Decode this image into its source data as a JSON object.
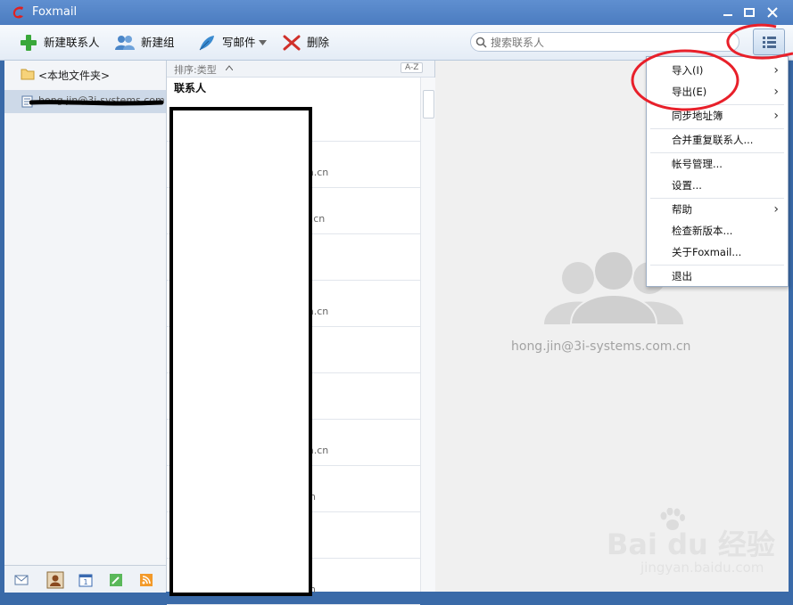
{
  "window": {
    "title": "Foxmail"
  },
  "toolbar": {
    "new_contact": "新建联系人",
    "new_group": "新建组",
    "write_mail": "写邮件",
    "delete": "删除"
  },
  "search": {
    "placeholder": "搜索联系人"
  },
  "sidebar": {
    "local_folder": "<本地文件夹>",
    "account": "hong.jin@3i-systems.com"
  },
  "list": {
    "sort_label": "排序:类型",
    "az_label": "A-Z",
    "group_label": "联系人",
    "rows": [
      {
        "email": ""
      },
      {
        "email": "m.cn"
      },
      {
        "email": "a.cn"
      },
      {
        "email": "o"
      },
      {
        "email": "m.cn"
      },
      {
        "email": ""
      },
      {
        "email": ""
      },
      {
        "email": "m.cn"
      },
      {
        "email": "cn"
      },
      {
        "email": ""
      },
      {
        "email": "cn"
      }
    ]
  },
  "detail": {
    "email": "hong.jin@3i-systems.com.cn"
  },
  "menu": {
    "items": [
      {
        "label": "导入(I)",
        "submenu": true
      },
      {
        "label": "导出(E)",
        "submenu": true
      },
      {
        "label": "同步地址簿",
        "submenu": true
      },
      {
        "label": "合并重复联系人...",
        "submenu": false
      },
      {
        "label": "帐号管理...",
        "submenu": false
      },
      {
        "label": "设置...",
        "submenu": false
      },
      {
        "label": "帮助",
        "submenu": true
      },
      {
        "label": "检查新版本...",
        "submenu": false
      },
      {
        "label": "关于Foxmail...",
        "submenu": false
      },
      {
        "label": "退出",
        "submenu": false
      }
    ]
  },
  "watermark": {
    "brand": "Bai du 经验",
    "url": "jingyan.baidu.com"
  },
  "colors": {
    "titlebar": "#4b7cc0",
    "annotation": "#e8202a",
    "selection": "#cdd9e8"
  }
}
